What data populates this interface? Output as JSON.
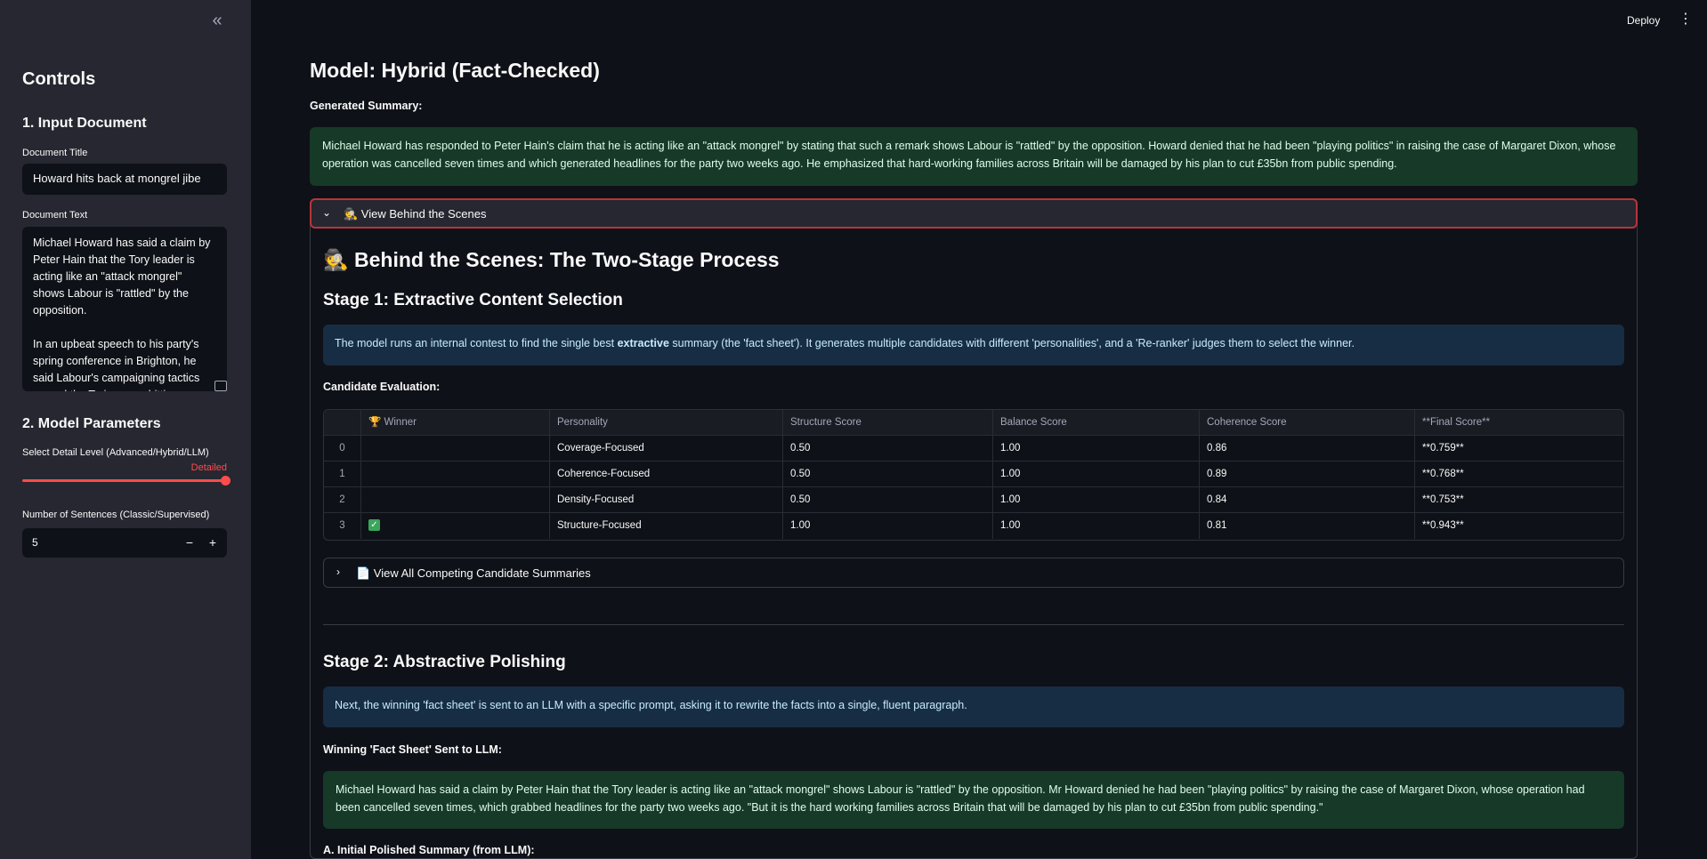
{
  "sidebar": {
    "collapse_icon": "«",
    "title": "Controls",
    "section1": "1. Input Document",
    "doc_title_label": "Document Title",
    "doc_title_value": "Howard hits back at mongrel jibe",
    "doc_text_label": "Document Text",
    "doc_text_value": "Michael Howard has said a claim by Peter Hain that the Tory leader is acting like an \"attack mongrel\" shows Labour is \"rattled\" by the opposition.\n\nIn an upbeat speech to his party's spring conference in Brighton, he said Labour's campaigning tactics proved the Tories were hitting",
    "section2": "2. Model Parameters",
    "detail_label": "Select Detail Level (Advanced/Hybrid/LLM)",
    "detail_value": "Detailed",
    "detail_level": 1.0,
    "sentences_label": "Number of Sentences (Classic/Supervised)",
    "sentences_value": "5",
    "minus": "−",
    "plus": "+"
  },
  "topbar": {
    "deploy": "Deploy",
    "menu_icon": "⋮"
  },
  "main": {
    "title": "Model: Hybrid (Fact-Checked)",
    "generated_label": "Generated Summary:",
    "summary": "Michael Howard has responded to Peter Hain's claim that he is acting like an \"attack mongrel\" by stating that such a remark shows Labour is \"rattled\" by the opposition. Howard denied that he had been \"playing politics\" in raising the case of Margaret Dixon, whose operation was cancelled seven times and which generated headlines for the party two weeks ago. He emphasized that hard-working families across Britain will be damaged by his plan to cut £35bn from public spending.",
    "expander_label": "🕵️ View Behind the Scenes",
    "behind_title": "🕵️ Behind the Scenes: The Two-Stage Process",
    "stage1_title": "Stage 1: Extractive Content Selection",
    "stage1_info_pre": "The model runs an internal contest to find the single best ",
    "stage1_info_bold": "extractive",
    "stage1_info_post": " summary (the 'fact sheet'). It generates multiple candidates with different 'personalities', and a 'Re-ranker' judges them to select the winner.",
    "candidate_label": "Candidate Evaluation:",
    "table": {
      "headers": [
        "",
        "🏆 Winner",
        "Personality",
        "Structure Score",
        "Balance Score",
        "Coherence Score",
        "**Final Score**"
      ],
      "rows": [
        {
          "idx": "0",
          "winner": "",
          "personality": "Coverage-Focused",
          "structure": "0.50",
          "balance": "1.00",
          "coherence": "0.86",
          "final": "**0.759**"
        },
        {
          "idx": "1",
          "winner": "",
          "personality": "Coherence-Focused",
          "structure": "0.50",
          "balance": "1.00",
          "coherence": "0.89",
          "final": "**0.768**"
        },
        {
          "idx": "2",
          "winner": "",
          "personality": "Density-Focused",
          "structure": "0.50",
          "balance": "1.00",
          "coherence": "0.84",
          "final": "**0.753**"
        },
        {
          "idx": "3",
          "winner": "✓",
          "personality": "Structure-Focused",
          "structure": "1.00",
          "balance": "1.00",
          "coherence": "0.81",
          "final": "**0.943**"
        }
      ]
    },
    "sub_expander_label": "📄 View All Competing Candidate Summaries",
    "stage2_title": "Stage 2: Abstractive Polishing",
    "stage2_info": "Next, the winning 'fact sheet' is sent to an LLM with a specific prompt, asking it to rewrite the facts into a single, fluent paragraph.",
    "fact_sheet_label": "Winning 'Fact Sheet' Sent to LLM:",
    "fact_sheet": "Michael Howard has said a claim by Peter Hain that the Tory leader is acting like an \"attack mongrel\" shows Labour is \"rattled\" by the opposition. Mr Howard denied he had been \"playing politics\" by raising the case of Margaret Dixon, whose operation had been cancelled seven times, which grabbed headlines for the party two weeks ago. \"But it is the hard working families across Britain that will be damaged by his plan to cut £35bn from public spending.\"",
    "initial_label": "A. Initial Polished Summary (from LLM):"
  }
}
